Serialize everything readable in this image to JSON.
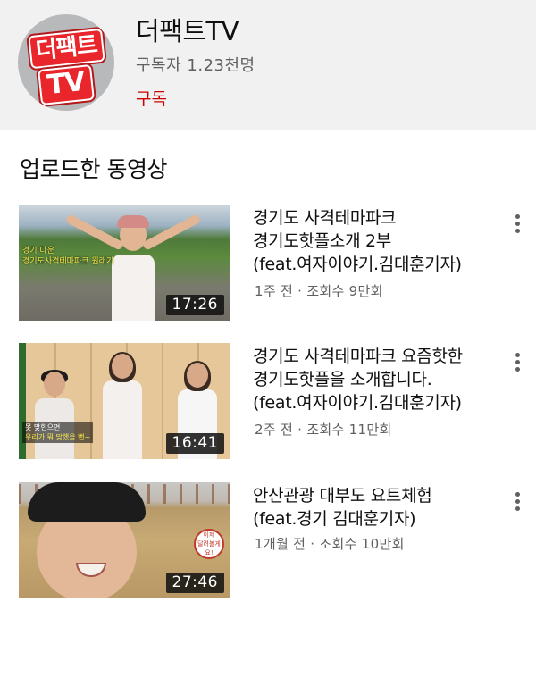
{
  "channel": {
    "logo_line1": "더팩트",
    "logo_line2": "TV",
    "name": "더팩트TV",
    "subscribers": "구독자 1.23천명",
    "subscribe_label": "구독"
  },
  "uploads": {
    "section_title": "업로드한 동영상",
    "videos": [
      {
        "title_lines": [
          "경기도 사격테마파크",
          "경기도핫플소개 2부",
          "(feat.여자이야기.김대훈기자)"
        ],
        "meta": "1주 전 · 조회수 9만회",
        "duration": "17:26",
        "thumb_caption": [
          "경기 다운",
          "경기도사격테마파크 원래기"
        ]
      },
      {
        "title_lines": [
          "경기도 사격테마파크 요즘핫한",
          "경기도핫플을 소개합니다.",
          "(feat.여자이야기.김대훈기자)"
        ],
        "meta": "2주 전 · 조회수 11만회",
        "duration": "16:41",
        "thumb_caption": [
          "못 맞힌으면",
          "우리가 뭐 맞했을 뻔~"
        ]
      },
      {
        "title_lines": [
          "안산관광 대부도 요트체험",
          "(feat.경기 김대훈기자)"
        ],
        "meta": "1개월 전 · 조회수 10만회",
        "duration": "27:46",
        "thumb_caption": [
          "이제",
          "달려볼게요!"
        ]
      }
    ]
  },
  "icons": {
    "more": "more-vert-icon"
  },
  "colors": {
    "header_bg": "#f1f1f1",
    "subscribe": "#cc0000",
    "logo_red": "#e8262b",
    "meta_text": "#606060"
  }
}
